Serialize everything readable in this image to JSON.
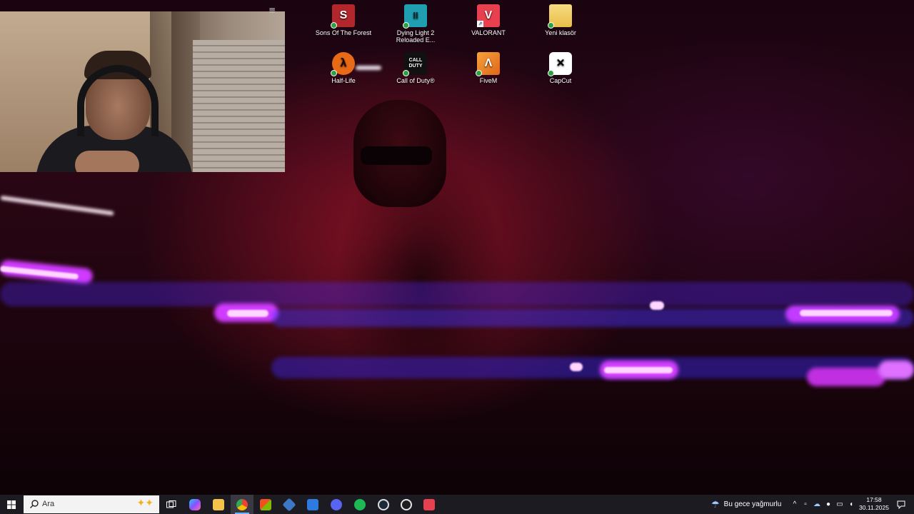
{
  "desktop": {
    "icons": [
      {
        "label": "Sons Of The Forest",
        "icon": "sons-of-the-forest-icon",
        "color": "#b3262b"
      },
      {
        "label": "Dying Light 2 Reloaded E...",
        "icon": "dying-light-2-icon",
        "color": "#1f9fb0"
      },
      {
        "label": "VALORANT",
        "icon": "valorant-icon",
        "color": "#e8404f"
      },
      {
        "label": "Yeni klasör",
        "icon": "folder-icon",
        "color": "#f3cf62"
      },
      {
        "label": "Half-Life",
        "icon": "half-life-icon",
        "color": "#e86a17"
      },
      {
        "label": "Call of Duty®",
        "icon": "call-of-duty-icon",
        "color": "#111111"
      },
      {
        "label": "FiveM",
        "icon": "fivem-icon",
        "color": "#f08a24"
      },
      {
        "label": "CapCut",
        "icon": "capcut-icon",
        "color": "#ffffff"
      }
    ],
    "hidden_icon_text": "≡"
  },
  "webcam": {
    "icon": "webcam-feed"
  },
  "taskbar": {
    "search_placeholder": "Ara",
    "apps": [
      {
        "name": "task-view",
        "icon": "task-view-icon",
        "color": "#ffffff"
      },
      {
        "name": "copilot",
        "icon": "copilot-icon",
        "color": "#7b5cf0"
      },
      {
        "name": "file-explorer",
        "icon": "folder-icon",
        "color": "#f3c34a"
      },
      {
        "name": "chrome",
        "icon": "chrome-icon",
        "color": "#4285f4"
      },
      {
        "name": "microsoft-store",
        "icon": "store-icon",
        "color": "#2b8ce6"
      },
      {
        "name": "vscode-like",
        "icon": "blue-app-icon",
        "color": "#3b78c8"
      },
      {
        "name": "mail",
        "icon": "mail-icon",
        "color": "#2d7be0"
      },
      {
        "name": "discord",
        "icon": "discord-icon",
        "color": "#5865f2"
      },
      {
        "name": "spotify",
        "icon": "spotify-icon",
        "color": "#1db954"
      },
      {
        "name": "steam",
        "icon": "steam-icon",
        "color": "#dddddd"
      },
      {
        "name": "obs",
        "icon": "obs-icon",
        "color": "#e6e6e6"
      },
      {
        "name": "valorant",
        "icon": "valorant-icon",
        "color": "#e8404f"
      }
    ],
    "weather_text": "Bu gece yağmurlu",
    "time": "17:58",
    "date": "30.11.2025"
  }
}
